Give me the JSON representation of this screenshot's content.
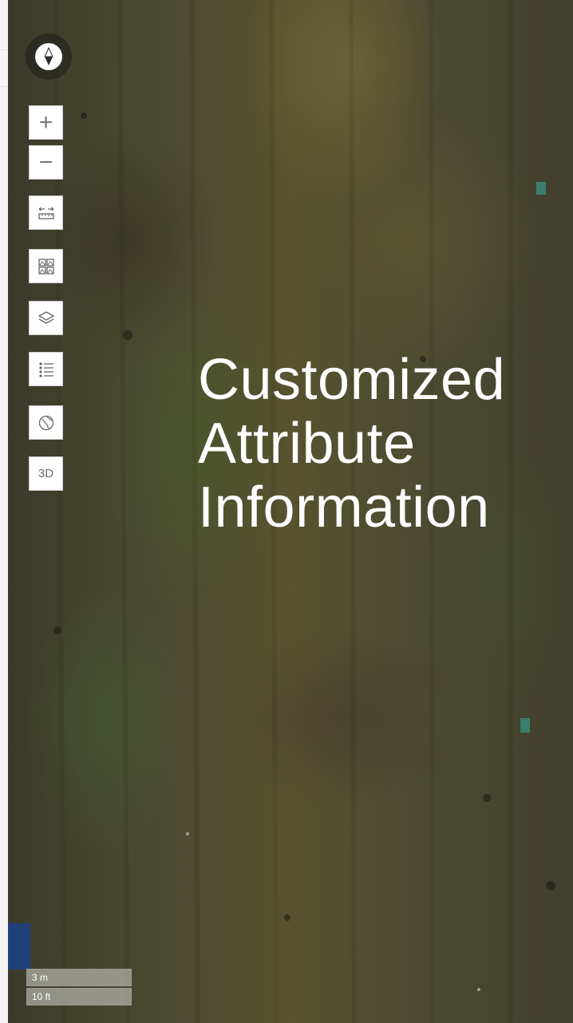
{
  "map": {
    "controls": {
      "compass_icon": "compass-icon",
      "zoom_in_icon": "plus-icon",
      "zoom_out_icon": "minus-icon",
      "measure_icon": "ruler-icon",
      "basemap_icon": "basemap-grid-icon",
      "layers_icon": "layers-icon",
      "legend_icon": "list-icon",
      "globe_icon": "globe-icon",
      "three_d_label": "3D"
    },
    "overlay_text": {
      "line1": "Customized",
      "line2": "Attribute",
      "line3": "Information"
    },
    "scale": {
      "metric": "3 m",
      "imperial": "10 ft"
    }
  }
}
